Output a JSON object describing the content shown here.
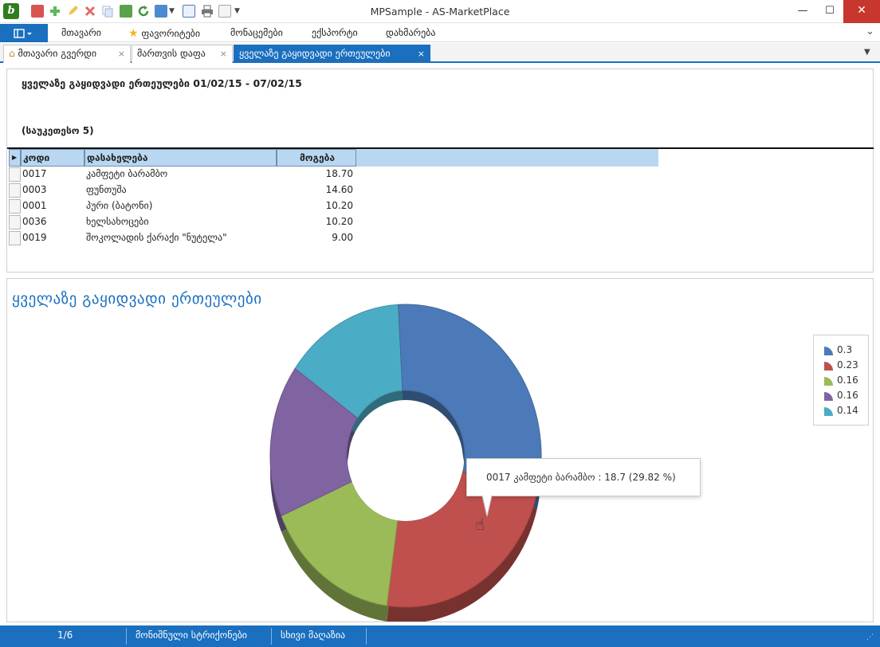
{
  "window": {
    "title": "MPSample - AS-MarketPlace",
    "app_icon_letter": "b",
    "controls": {
      "minimize": "—",
      "maximize": "☐",
      "close": "✕"
    }
  },
  "menu": {
    "items": [
      "მთავარი",
      "ფავორიტები",
      "მონაცემები",
      "ექსპორტი",
      "დახმარება"
    ],
    "star_color": "#f2b619"
  },
  "tabs": [
    {
      "label": "მთავარი გვერდი",
      "close": "×",
      "active": false
    },
    {
      "label": "მართვის დაფა",
      "close": "×",
      "active": false
    },
    {
      "label": "ყველაზე გაყიდვადი ერთეულები",
      "close": "×",
      "active": true
    }
  ],
  "report": {
    "title": "ყველაზე გაყიდვადი ერთეულები  01/02/15 - 07/02/15",
    "subtitle": "(საუკეთესო 5)",
    "columns": [
      "კოდი",
      "დასახელება",
      "მოგება"
    ],
    "rows": [
      {
        "code": "0017",
        "name": "კამფეტი ბარამბო",
        "profit": "18.70"
      },
      {
        "code": "0003",
        "name": "ფუნთუშა",
        "profit": "14.60"
      },
      {
        "code": "0001",
        "name": "პური (ბატონი)",
        "profit": "10.20"
      },
      {
        "code": "0036",
        "name": "ხელსახოცები",
        "profit": "10.20"
      },
      {
        "code": "0019",
        "name": "შოკოლადის ქარაქი \"ნუტელა\"",
        "profit": "9.00"
      }
    ]
  },
  "chart": {
    "title": "ყველაზე გაყიდვადი ერთეულები",
    "tooltip": "0017 კამფეტი ბარამბო : 18.7 (29.82 %)"
  },
  "chart_data": {
    "type": "pie",
    "variant": "donut-3d",
    "legend_position": "right",
    "categories": [
      "0.3",
      "0.23",
      "0.16",
      "0.16",
      "0.14"
    ],
    "values": [
      18.7,
      14.6,
      10.2,
      10.2,
      9.0
    ],
    "colors": [
      "#4c7ab8",
      "#c0504d",
      "#9bbb59",
      "#8064a2",
      "#4bacc6"
    ]
  },
  "status": {
    "page": "1/6",
    "items": [
      "მონიშნული სტრიქონები",
      "სხივი მაღაზია"
    ]
  },
  "colors": {
    "accent": "#1a6fbf",
    "close": "#c7372d"
  }
}
